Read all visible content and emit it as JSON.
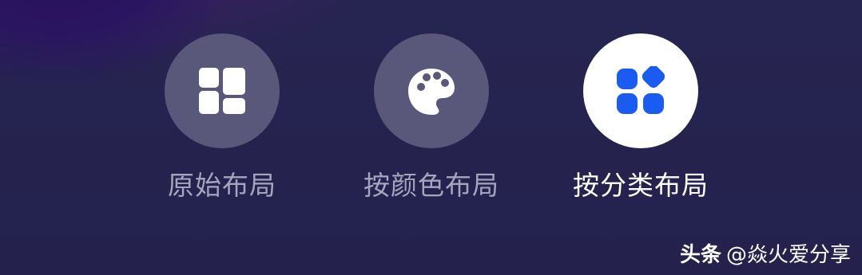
{
  "layout_options": [
    {
      "label": "原始布局",
      "icon": "grid-layout-icon",
      "selected": false
    },
    {
      "label": "按颜色布局",
      "icon": "palette-icon",
      "selected": false
    },
    {
      "label": "按分类布局",
      "icon": "category-grid-icon",
      "selected": true
    }
  ],
  "watermark": {
    "brand": "头条",
    "handle": "@焱火爱分享"
  },
  "colors": {
    "background": "#25234f",
    "inactive_circle": "#59577a",
    "active_circle": "#ffffff",
    "inactive_label": "#a6a5be",
    "active_label": "#ffffff",
    "active_icon": "#1a5cf2"
  }
}
